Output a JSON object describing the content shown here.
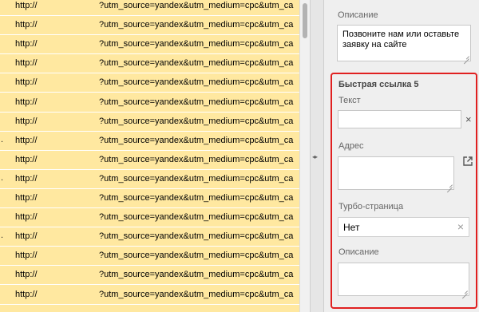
{
  "table": {
    "rows": [
      {
        "lead": "",
        "http": "http://",
        "utm": "?utm_source=yandex&utm_medium=cpc&utm_ca"
      },
      {
        "lead": "",
        "http": "http://",
        "utm": "?utm_source=yandex&utm_medium=cpc&utm_ca"
      },
      {
        "lead": "",
        "http": "http://",
        "utm": "?utm_source=yandex&utm_medium=cpc&utm_ca"
      },
      {
        "lead": "",
        "http": "http://",
        "utm": "?utm_source=yandex&utm_medium=cpc&utm_ca"
      },
      {
        "lead": "",
        "http": "http://",
        "utm": "?utm_source=yandex&utm_medium=cpc&utm_ca"
      },
      {
        "lead": "",
        "http": "http://",
        "utm": "?utm_source=yandex&utm_medium=cpc&utm_ca"
      },
      {
        "lead": "",
        "http": "http://",
        "utm": "?utm_source=yandex&utm_medium=cpc&utm_ca"
      },
      {
        "lead": ".",
        "http": "http://",
        "utm": "?utm_source=yandex&utm_medium=cpc&utm_ca"
      },
      {
        "lead": "",
        "http": "http://",
        "utm": "?utm_source=yandex&utm_medium=cpc&utm_ca"
      },
      {
        "lead": ".",
        "http": "http://",
        "utm": "?utm_source=yandex&utm_medium=cpc&utm_ca"
      },
      {
        "lead": "",
        "http": "http://",
        "utm": "?utm_source=yandex&utm_medium=cpc&utm_ca"
      },
      {
        "lead": "",
        "http": "http://",
        "utm": "?utm_source=yandex&utm_medium=cpc&utm_ca"
      },
      {
        "lead": ".",
        "http": "http://",
        "utm": "?utm_source=yandex&utm_medium=cpc&utm_ca"
      },
      {
        "lead": "",
        "http": "http://",
        "utm": "?utm_source=yandex&utm_medium=cpc&utm_ca"
      },
      {
        "lead": "",
        "http": "http://",
        "utm": "?utm_source=yandex&utm_medium=cpc&utm_ca"
      },
      {
        "lead": "",
        "http": "http://",
        "utm": "?utm_source=yandex&utm_medium=cpc&utm_ca"
      }
    ],
    "row_color": "#ffe8a0"
  },
  "panel": {
    "description_label": "Описание",
    "description_value": "Позвоните нам или оставьте заявку на сайте",
    "quicklink": {
      "title": "Быстрая ссылка 5",
      "text_label": "Текст",
      "text_value": "",
      "address_label": "Адрес",
      "address_value": "",
      "turbo_label": "Турбо-страница",
      "turbo_value": "Нет",
      "description_label": "Описание",
      "description_value": "",
      "border_color": "#e02020"
    }
  },
  "icons": {
    "clear": "×",
    "external_link": "external-link-icon",
    "splitter": "◂▸"
  }
}
